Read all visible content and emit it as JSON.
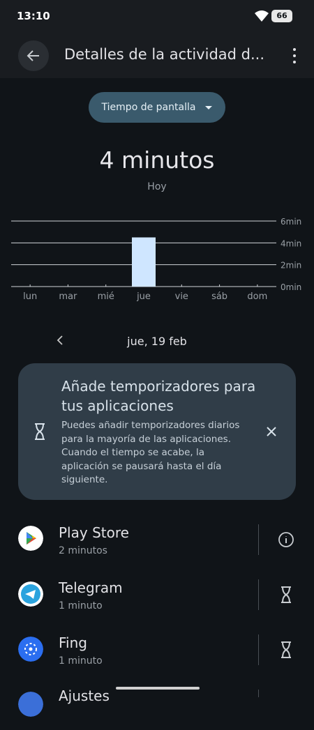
{
  "status_bar": {
    "time": "13:10",
    "battery": "66"
  },
  "app_bar": {
    "title": "Detalles de la actividad d..."
  },
  "dropdown": {
    "label": "Tiempo de pantalla"
  },
  "summary": {
    "total": "4 minutos",
    "period": "Hoy"
  },
  "chart_data": {
    "type": "bar",
    "categories": [
      "lun",
      "mar",
      "mié",
      "jue",
      "vie",
      "sáb",
      "dom"
    ],
    "values": [
      0,
      0,
      0,
      4.5,
      0,
      0,
      0
    ],
    "y_ticks": [
      "6min",
      "4min",
      "2min",
      "0min"
    ],
    "ylim": [
      0,
      6
    ],
    "highlight_color": "#cfe6ff"
  },
  "date_nav": {
    "date": "jue, 19 feb"
  },
  "timer_card": {
    "title": "Añade temporizadores para tus aplicaciones",
    "body": "Puedes añadir temporizadores diarios para la mayoría de las aplicaciones. Cuando el tiempo se acabe, la aplicación se pausará hasta el día siguiente."
  },
  "apps": [
    {
      "name": "Play Store",
      "time": "2 minutos",
      "action_icon": "info-icon"
    },
    {
      "name": "Telegram",
      "time": "1 minuto",
      "action_icon": "hourglass-icon"
    },
    {
      "name": "Fing",
      "time": "1 minuto",
      "action_icon": "hourglass-icon"
    },
    {
      "name": "Ajustes",
      "time": "",
      "action_icon": "hourglass-icon"
    }
  ]
}
